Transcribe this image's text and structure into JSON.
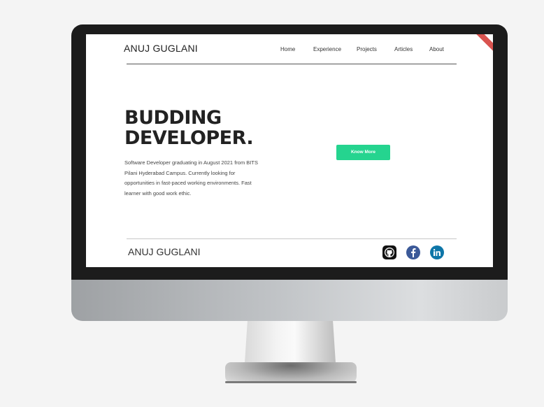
{
  "site": {
    "brand": "ANUJ GUGLANI",
    "nav": [
      "Home",
      "Experience",
      "Projects",
      "Articles",
      "About"
    ]
  },
  "hero": {
    "headline_line1": "BUDDING",
    "headline_line2": "DEVELOPER.",
    "description": "Software Developer graduating in August 2021 from BITS Pilani Hyderabad Campus. Currently looking for opportunities in fast-paced working environments. Fast learner with good work ethic.",
    "cta_label": "Know More"
  },
  "footer": {
    "brand": "ANUJ GUGLANI",
    "social_icons": [
      "github-icon",
      "facebook-icon",
      "linkedin-icon"
    ]
  },
  "colors": {
    "accent": "#25d48f",
    "text_dark": "#222222",
    "facebook": "#3b5998",
    "linkedin": "#0e76a8"
  }
}
